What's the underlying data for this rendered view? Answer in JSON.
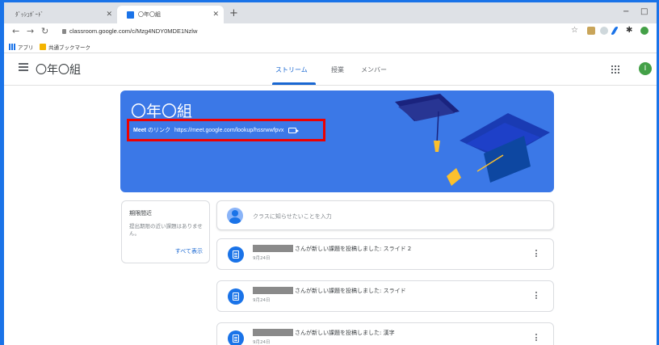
{
  "browser": {
    "tabs": [
      {
        "label": "ﾀﾞｯｼｭﾎﾞｰﾄﾞ",
        "active": false
      },
      {
        "label": "〇年〇組",
        "active": true
      }
    ],
    "new_tab": "+",
    "window_controls": {
      "minimize": "−",
      "maximize": "□"
    },
    "url": "classroom.google.com/c/Mzg4NDY0MDE1Nzlw",
    "bookmarks": [
      {
        "label": "アプリ",
        "icon": "apps-icon"
      },
      {
        "label": "共通ブックマーク",
        "icon": "folder-icon"
      }
    ]
  },
  "header": {
    "class_name": "〇年〇組",
    "tabs": [
      {
        "label": "ストリーム",
        "active": true
      },
      {
        "label": "授業",
        "active": false
      },
      {
        "label": "メンバー",
        "active": false
      }
    ],
    "avatar_initial": "I"
  },
  "banner": {
    "title": "〇年〇組",
    "meet_label": "Meet",
    "meet_suffix": "のリンク",
    "meet_link": "https://meet.google.com/lookup/hssrwwfpvx"
  },
  "upcoming": {
    "title": "期限間近",
    "description": "提出期限の近い課題はありません。",
    "view_all": "すべて表示"
  },
  "announce": {
    "placeholder": "クラスに知らせたいことを入力"
  },
  "posts": [
    {
      "title": "さんが新しい課題を投稿しました: スライド 2",
      "date": "9月24日"
    },
    {
      "title": "さんが新しい課題を投稿しました: スライド",
      "date": "9月24日"
    },
    {
      "title": "さんが新しい課題を投稿しました: 漢字",
      "date": "9月24日"
    }
  ],
  "colors": {
    "accent": "#1967d2",
    "banner": "#3b78e7",
    "highlight_border": "#e00000",
    "avatar": "#43a047"
  }
}
